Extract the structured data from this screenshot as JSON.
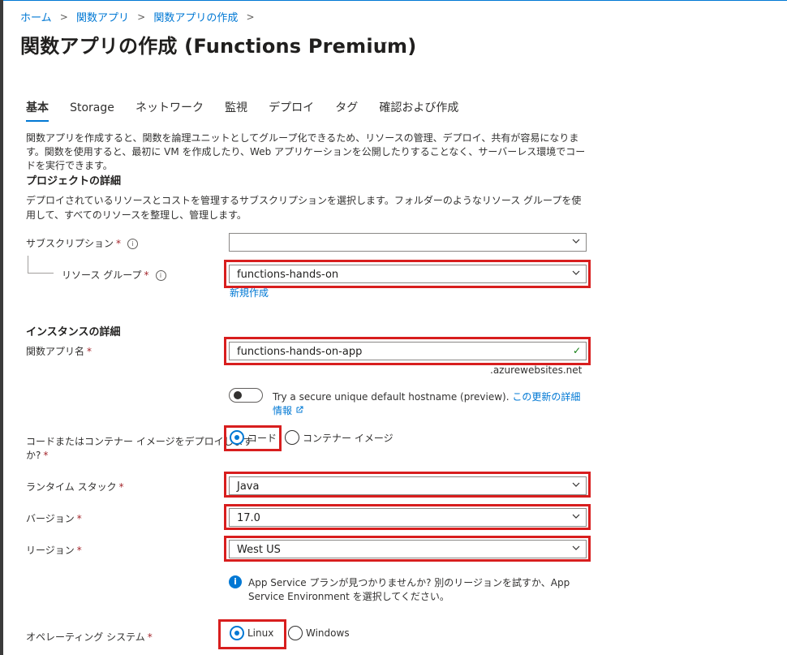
{
  "breadcrumb": [
    "ホーム",
    "関数アプリ",
    "関数アプリの作成"
  ],
  "page": {
    "title": "関数アプリの作成 (Functions Premium)",
    "more_label": "···"
  },
  "tabs": [
    "基本",
    "Storage",
    "ネットワーク",
    "監視",
    "デプロイ",
    "タグ",
    "確認および作成"
  ],
  "intro": {
    "text": "関数アプリを作成すると、関数を論理ユニットとしてグループ化できるため、リソースの管理、デプロイ、共有が容易になります。関数を使用すると、最初に VM を作成したり、Web アプリケーションを公開したりすることなく、サーバーレス環境でコードを実行できます。"
  },
  "project": {
    "title": "プロジェクトの詳細",
    "description": "デプロイされているリソースとコストを管理するサブスクリプションを選択します。フォルダーのようなリソース グループを使用して、すべてのリソースを整理し、管理します。",
    "subscription_label": "サブスクリプション",
    "subscription_value": "",
    "resource_group_label": "リソース グループ",
    "resource_group_value": "functions-hands-on",
    "new_link": "新規作成"
  },
  "instance": {
    "title": "インスタンスの詳細",
    "app_name_label": "関数アプリ名",
    "app_name_value": "functions-hands-on-app",
    "suffix": ".azurewebsites.net",
    "toggle_text": "Try a secure unique default hostname (preview).",
    "toggle_link": "この更新の詳細情報",
    "deploy_label_line1": "コードまたはコンテナー イメージをデプロイします",
    "deploy_label_line2": "か?",
    "deploy_options": [
      "コード",
      "コンテナー イメージ"
    ],
    "runtime_label": "ランタイム スタック",
    "runtime_value": "Java",
    "version_label": "バージョン",
    "version_value": "17.0",
    "region_label": "リージョン",
    "region_value": "West US",
    "region_info": "App Service プランが見つかりませんか? 別のリージョンを試すか、App Service Environment を選択してください。",
    "os_label": "オペレーティング システム",
    "os_options": [
      "Linux",
      "Windows"
    ]
  },
  "required_mark": "*",
  "colors": {
    "accent": "#0078d4",
    "required": "#a4262c",
    "highlight": "#d81e1e",
    "valid": "#107c10"
  },
  "icons": {
    "breadcrumb_separator": "chevron-right-icon",
    "select_arrow": "chevron-down-icon",
    "valid": "checkmark-icon",
    "info": "info-icon",
    "external_link": "external-link-icon"
  }
}
